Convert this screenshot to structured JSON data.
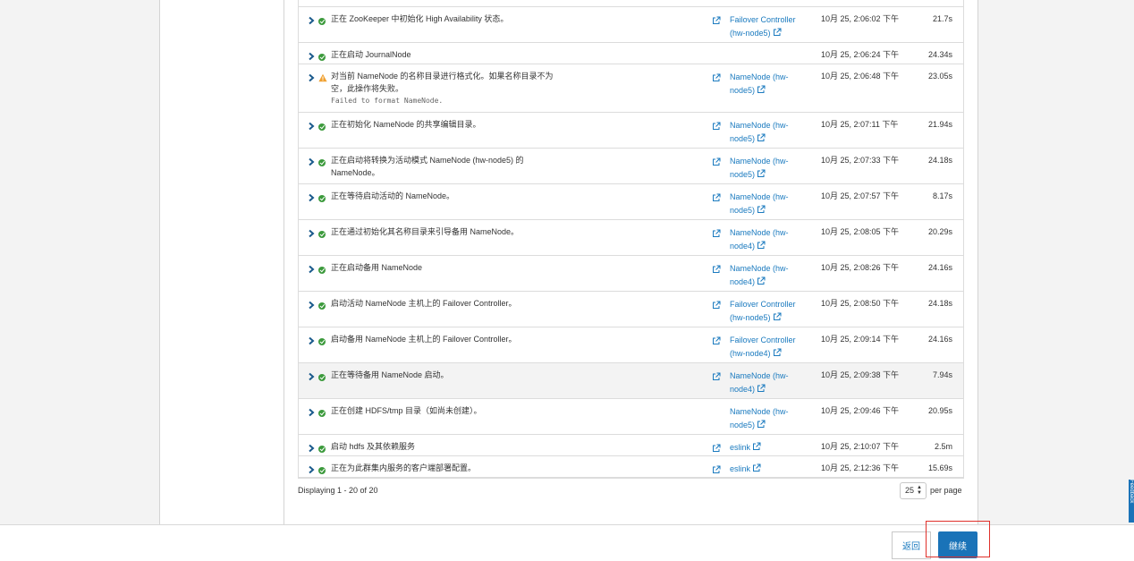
{
  "rows": [
    {
      "status": "ok",
      "desc": "正在 ZooKeeper 中初始化 High Availability 状态。",
      "role_l1": "Failover Controller",
      "role_l2": "(hw-node5)",
      "ext": true,
      "time": "10月 25, 2:06:02 下午",
      "dur": "21.7s"
    },
    {
      "status": "ok",
      "desc": "正在启动 JournalNode",
      "role_l1": "",
      "role_l2": "",
      "ext": false,
      "time": "10月 25, 2:06:24 下午",
      "dur": "24.34s"
    },
    {
      "status": "warn",
      "desc": "对当前 NameNode 的名称目录进行格式化。如果名称目录不为",
      "desc2": "空，此操作将失败。",
      "err": "Failed to format NameNode.",
      "role_l1": "NameNode (hw-",
      "role_l2": "node5)",
      "ext": true,
      "time": "10月 25, 2:06:48 下午",
      "dur": "23.05s"
    },
    {
      "status": "ok",
      "desc": "正在初始化 NameNode 的共享编辑目录。",
      "role_l1": "NameNode (hw-",
      "role_l2": "node5)",
      "ext": true,
      "time": "10月 25, 2:07:11 下午",
      "dur": "21.94s"
    },
    {
      "status": "ok",
      "desc": "正在启动将转换为活动模式 NameNode (hw-node5) 的",
      "desc2": "NameNode。",
      "role_l1": "NameNode (hw-",
      "role_l2": "node5)",
      "ext": true,
      "time": "10月 25, 2:07:33 下午",
      "dur": "24.18s"
    },
    {
      "status": "ok",
      "desc": "正在等待启动活动的 NameNode。",
      "role_l1": "NameNode (hw-",
      "role_l2": "node5)",
      "ext": true,
      "time": "10月 25, 2:07:57 下午",
      "dur": "8.17s"
    },
    {
      "status": "ok",
      "desc": "正在通过初始化其名称目录来引导备用 NameNode。",
      "role_l1": "NameNode (hw-",
      "role_l2": "node4)",
      "ext": true,
      "time": "10月 25, 2:08:05 下午",
      "dur": "20.29s"
    },
    {
      "status": "ok",
      "desc": "正在启动备用 NameNode",
      "role_l1": "NameNode (hw-",
      "role_l2": "node4)",
      "ext": true,
      "time": "10月 25, 2:08:26 下午",
      "dur": "24.16s"
    },
    {
      "status": "ok",
      "desc": "启动活动 NameNode 主机上的 Failover Controller。",
      "role_l1": "Failover Controller",
      "role_l2": "(hw-node5)",
      "ext": true,
      "time": "10月 25, 2:08:50 下午",
      "dur": "24.18s"
    },
    {
      "status": "ok",
      "desc": "启动备用 NameNode 主机上的 Failover Controller。",
      "role_l1": "Failover Controller",
      "role_l2": "(hw-node4)",
      "ext": true,
      "time": "10月 25, 2:09:14 下午",
      "dur": "24.16s"
    },
    {
      "status": "ok",
      "desc": "正在等待备用 NameNode 启动。",
      "role_l1": "NameNode (hw-",
      "role_l2": "node4)",
      "ext": true,
      "time": "10月 25, 2:09:38 下午",
      "dur": "7.94s",
      "highlight": true
    },
    {
      "status": "ok",
      "desc": "正在创建 HDFS/tmp 目录（如尚未创建）。",
      "role_l1": "NameNode (hw-",
      "role_l2": "node5)",
      "ext": false,
      "time": "10月 25, 2:09:46 下午",
      "dur": "20.95s"
    },
    {
      "status": "ok",
      "desc": "启动 hdfs 及其依赖服务",
      "role_l1": "eslink",
      "role_l2": "",
      "ext": true,
      "time": "10月 25, 2:10:07 下午",
      "dur": "2.5m"
    },
    {
      "status": "ok",
      "desc": "正在为此群集内服务的客户端部署配置。",
      "role_l1": "eslink",
      "role_l2": "",
      "ext": true,
      "time": "10月 25, 2:12:36 下午",
      "dur": "15.69s"
    }
  ],
  "footer": {
    "displaying": "Displaying 1 - 20 of 20",
    "per_page_value": "25",
    "per_page_label": "per page"
  },
  "buttons": {
    "back": "返回",
    "continue": "继续"
  },
  "feedback": "Feedback",
  "colors": {
    "link": "#1a7abf",
    "primary": "#1a73b8",
    "success": "#3c9a3c",
    "warning": "#f0a030",
    "highlight_box": "#e0302a"
  }
}
